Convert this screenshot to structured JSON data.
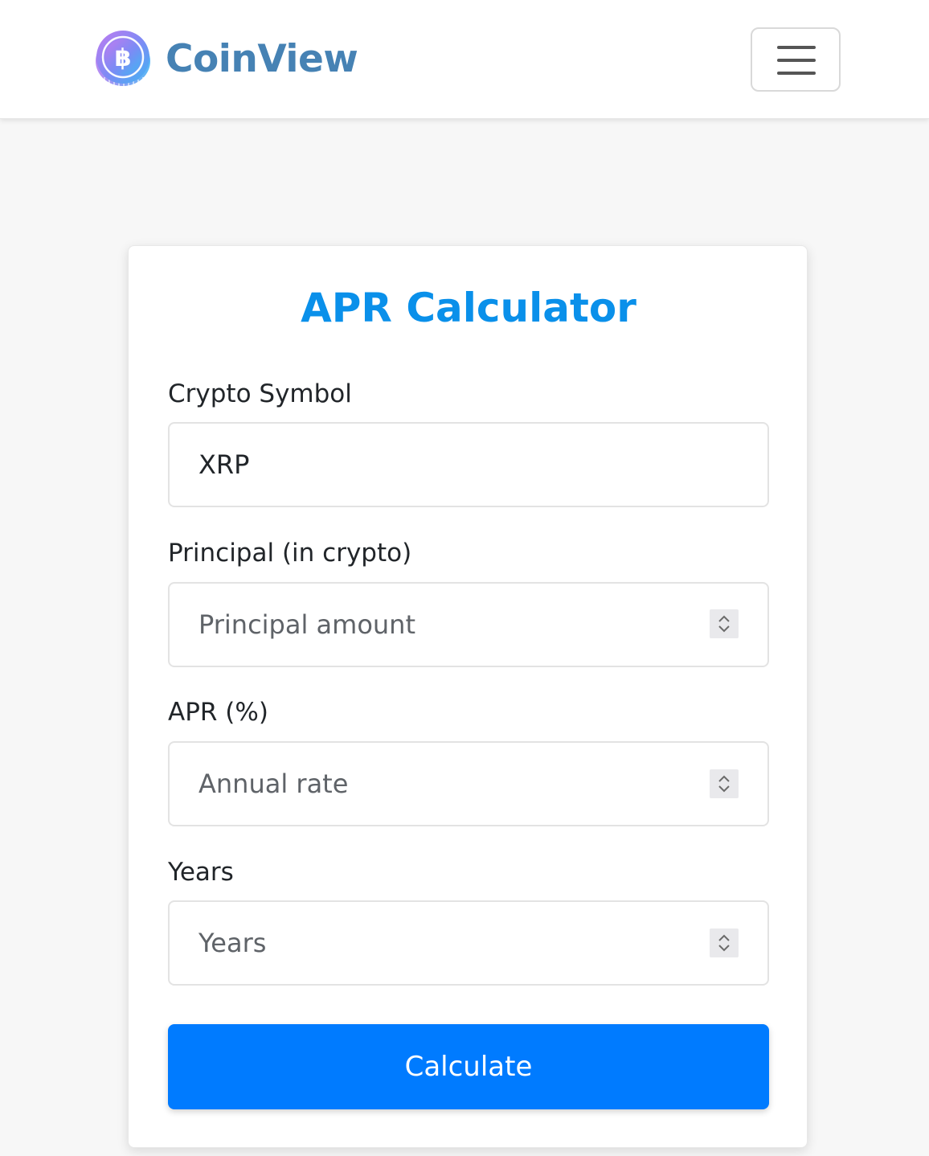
{
  "header": {
    "brand_name": "CoinView",
    "logo_icon": "bitcoin-coin-icon",
    "menu_icon": "hamburger-menu-icon"
  },
  "calculator": {
    "title": "APR Calculator",
    "fields": [
      {
        "label": "Crypto Symbol",
        "value": "XRP",
        "placeholder": "",
        "type": "text"
      },
      {
        "label": "Principal (in crypto)",
        "value": "",
        "placeholder": "Principal amount",
        "type": "number"
      },
      {
        "label": "APR (%)",
        "value": "",
        "placeholder": "Annual rate",
        "type": "number"
      },
      {
        "label": "Years",
        "value": "",
        "placeholder": "Years",
        "type": "number"
      }
    ],
    "submit_label": "Calculate"
  },
  "colors": {
    "brand": "#4682b4",
    "title": "#0a90ea",
    "primary_button": "#007bff",
    "page_background": "#f7f7f7"
  }
}
